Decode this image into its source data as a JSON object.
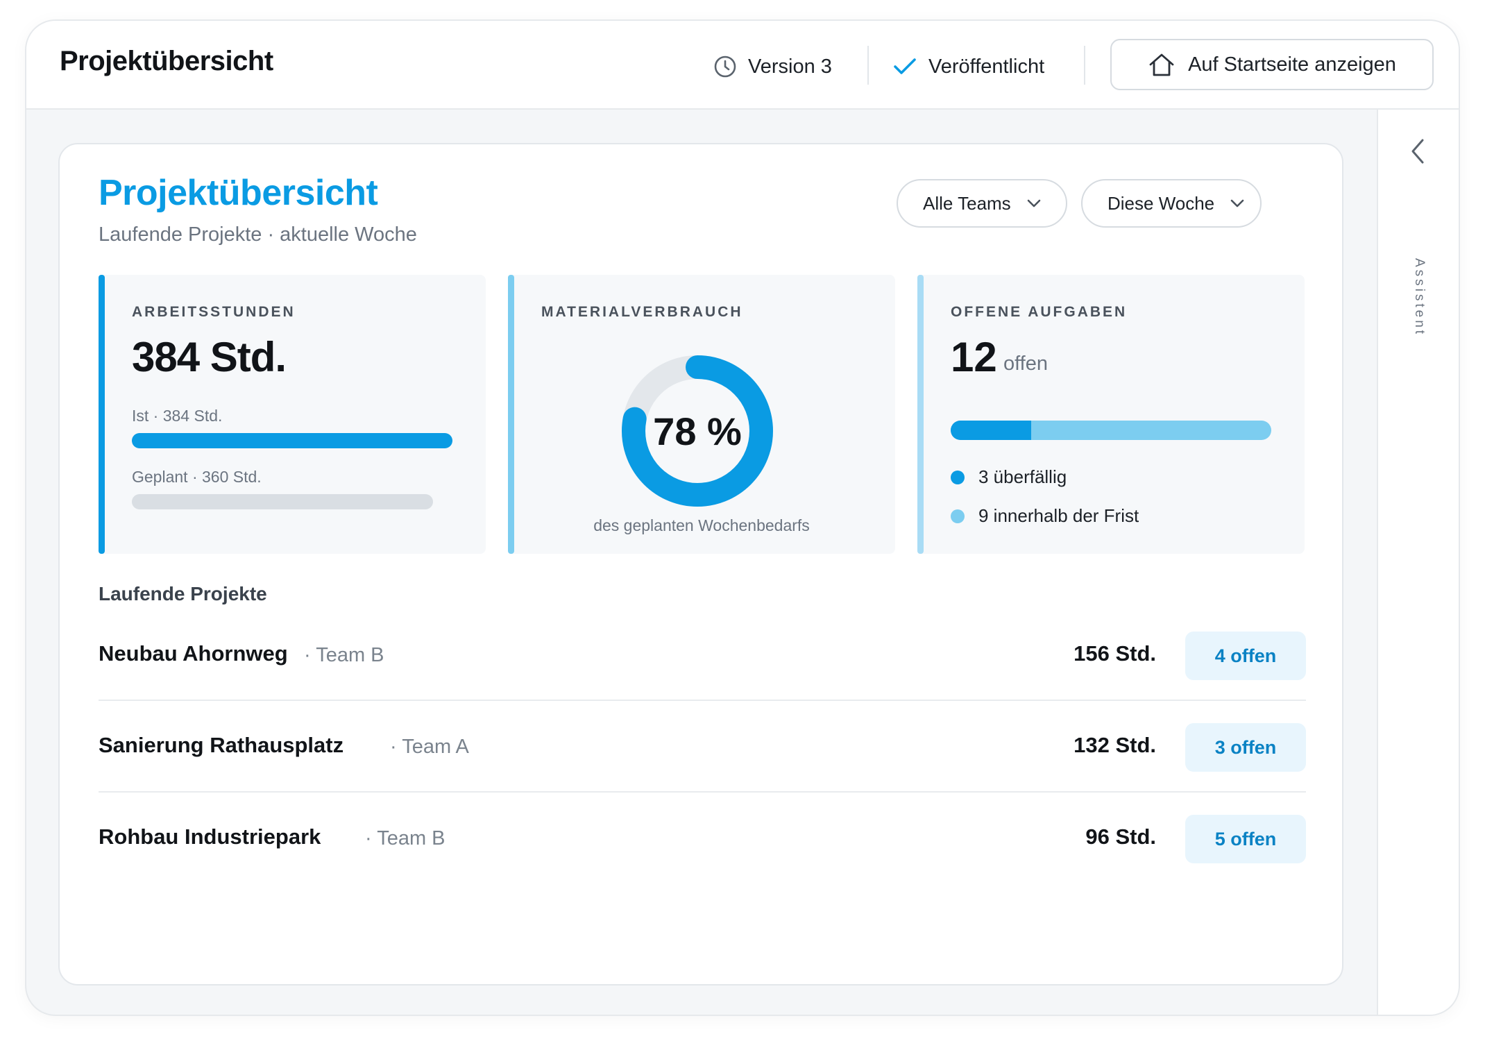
{
  "header": {
    "title": "Projektübersicht",
    "version": "Version 3",
    "status": "Veröffentlicht",
    "home_button": "Auf Startseite anzeigen"
  },
  "sidebar": {
    "label": "Assistent"
  },
  "main": {
    "title": "Projektübersicht",
    "subtitle": "Laufende Projekte · aktuelle Woche",
    "filters": {
      "teams": "Alle Teams",
      "period": "Diese Woche"
    }
  },
  "kpis": {
    "hours": {
      "label": "ARBEITSSTUNDEN",
      "value": "384 Std.",
      "actual_label": "Ist · 384 Std.",
      "planned_label": "Geplant · 360 Std.",
      "actual": 384,
      "planned": 360
    },
    "material": {
      "label": "MATERIALVERBRAUCH",
      "value_text": "78 %",
      "percent": 78,
      "caption": "des geplanten Wochenbedarfs"
    },
    "tasks": {
      "label": "OFFENE AUFGABEN",
      "count": "12",
      "unit": "offen",
      "overdue": 3,
      "on_time": 9,
      "overdue_label": "3 überfällig",
      "on_time_label": "9 innerhalb der Frist"
    }
  },
  "projects": {
    "heading": "Laufende Projekte",
    "rows": [
      {
        "name": "Neubau Ahornweg",
        "team": "· Team B",
        "hours": "156 Std.",
        "badge": "4 offen"
      },
      {
        "name": "Sanierung Rathausplatz",
        "team": "· Team A",
        "hours": "132 Std.",
        "badge": "3 offen"
      },
      {
        "name": "Rohbau Industriepark",
        "team": "· Team B",
        "hours": "96 Std.",
        "badge": "5 offen"
      }
    ]
  },
  "colors": {
    "accent": "#0a9be3",
    "accent_light": "#7ccdf0",
    "track": "#e3e7eb",
    "badge_bg": "#e8f5fd"
  },
  "icons": {
    "version": "clock-icon",
    "status": "check-icon",
    "home": "home-icon",
    "sidebar_toggle": "chevron-left-icon",
    "filter": "chevron-down-icon"
  }
}
